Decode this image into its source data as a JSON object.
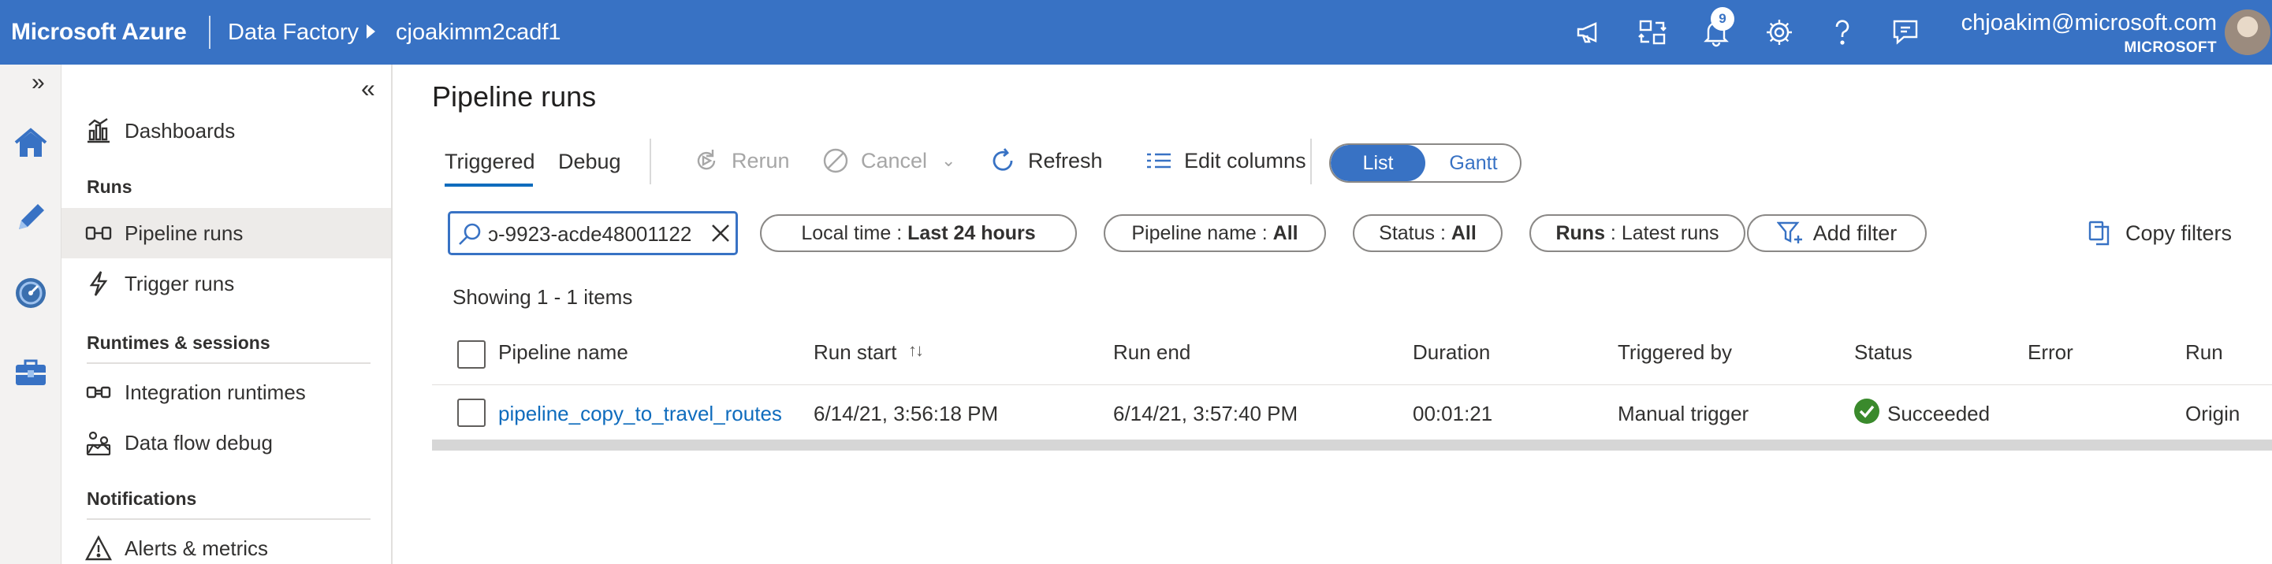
{
  "header": {
    "brand": "Microsoft Azure",
    "breadcrumb": [
      "Data Factory",
      "cjoakimm2cadf1"
    ],
    "notification_count": "9",
    "user_email": "chjoakim@microsoft.com",
    "user_org": "MICROSOFT",
    "icons": [
      "announcement-icon",
      "switch-directory-icon",
      "bell-icon",
      "gear-icon",
      "help-icon",
      "feedback-icon"
    ],
    "accent_color": "#3872c4"
  },
  "rail": {
    "expand": "»",
    "items": [
      "home-icon",
      "author-pencil-icon",
      "monitor-icon",
      "manage-toolbox-icon"
    ]
  },
  "nav": {
    "collapse": "«",
    "dashboards": "Dashboards",
    "runs_header": "Runs",
    "pipeline_runs": "Pipeline runs",
    "trigger_runs": "Trigger runs",
    "runtimes_header": "Runtimes & sessions",
    "integration_runtimes": "Integration runtimes",
    "data_flow_debug": "Data flow debug",
    "notifications_header": "Notifications",
    "alerts_metrics": "Alerts & metrics"
  },
  "main": {
    "title": "Pipeline runs",
    "tabs": {
      "triggered": "Triggered",
      "debug": "Debug"
    },
    "toolbar": {
      "rerun": "Rerun",
      "cancel": "Cancel",
      "refresh": "Refresh",
      "edit_columns": "Edit columns",
      "view_list": "List",
      "view_gantt": "Gantt"
    },
    "search_value": "ɔ-9923-acde48001122",
    "filters": {
      "time_label": "Local time : ",
      "time_value": "Last 24 hours",
      "pipeline_label": "Pipeline name : ",
      "pipeline_value": "All",
      "status_label": "Status : ",
      "status_value": "All",
      "runs_label": "Runs",
      "runs_value": " : Latest runs",
      "add_filter": "Add filter",
      "copy_filters": "Copy filters"
    },
    "showing": "Showing 1 - 1 items",
    "columns": [
      "Pipeline name",
      "Run start",
      "Run end",
      "Duration",
      "Triggered by",
      "Status",
      "Error",
      "Run"
    ],
    "rows": [
      {
        "pipeline_name": "pipeline_copy_to_travel_routes",
        "run_start": "6/14/21, 3:56:18 PM",
        "run_end": "6/14/21, 3:57:40 PM",
        "duration": "00:01:21",
        "triggered_by": "Manual trigger",
        "status": "Succeeded",
        "error": "",
        "run": "Origin"
      }
    ],
    "status_success_color": "#3a8a2c",
    "link_color": "#0f6cbd"
  }
}
